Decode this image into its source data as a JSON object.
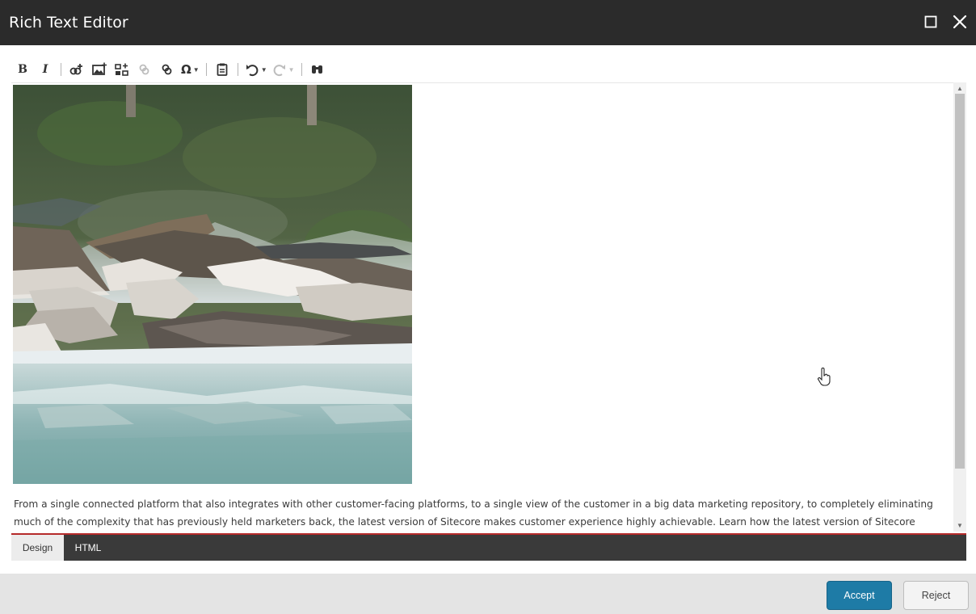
{
  "window": {
    "title": "Rich Text Editor"
  },
  "toolbar": {
    "bold_label": "B",
    "italic_label": "I",
    "symbol_label": "Ω",
    "icons": [
      "bold",
      "italic",
      "insert-link-icon",
      "insert-image-icon",
      "insert-media-icon",
      "link-disabled-icon",
      "unlink-icon",
      "special-symbol-icon",
      "paste-icon",
      "undo-icon",
      "redo-icon",
      "find-icon"
    ]
  },
  "editor": {
    "paragraph": "From a single connected platform that also integrates with other customer-facing platforms, to a single view of the customer in a big data marketing repository, to completely eliminating much of the complexity that has previously held marketers back, the latest version of Sitecore makes customer experience highly achievable. Learn how the latest version of Sitecore gives marketers the"
  },
  "mode_tabs": {
    "design": "Design",
    "html": "HTML"
  },
  "footer": {
    "accept_label": "Accept",
    "reject_label": "Reject"
  },
  "colors": {
    "titlebar": "#2b2b2b",
    "accent": "#1e7ba6",
    "divider_red": "#b52a2a",
    "modebar": "#3a3a3a"
  }
}
